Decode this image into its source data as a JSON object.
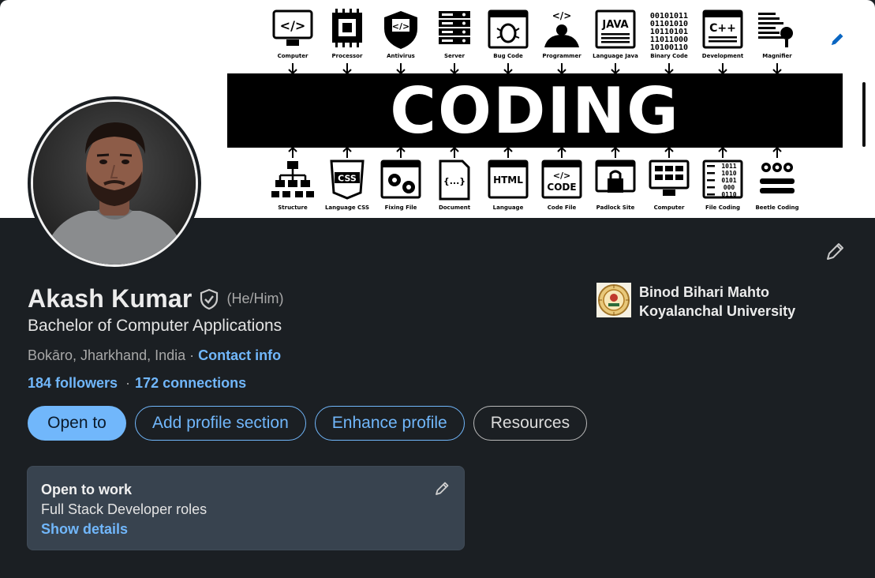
{
  "banner": {
    "top_icons": [
      "Computer",
      "Processor",
      "Antivirus",
      "Server",
      "Bug Code",
      "Programmer",
      "Language Java",
      "Binary Code",
      "Development",
      "Magnifier"
    ],
    "bottom_icons": [
      "Structure",
      "Language CSS",
      "Fixing File",
      "Document",
      "Language",
      "Code File",
      "Padlock Site",
      "Computer",
      "File Coding",
      "Beetle Coding"
    ],
    "title": "CODING",
    "binary_text": [
      "00101011",
      "01101010",
      "10110101",
      "11011000",
      "10100110"
    ],
    "icon_texts": {
      "computer": "</>",
      "antivirus": "</>",
      "programmer": "</>",
      "java": "JAVA",
      "cpp": "C++",
      "css": "CSS",
      "document": "{...}",
      "html": "HTML",
      "code_top": "</>",
      "code_bottom": "CODE",
      "file_binary": [
        "1011",
        "1010",
        "0101",
        "000",
        "0110"
      ]
    }
  },
  "profile": {
    "name": "Akash Kumar",
    "pronouns": "(He/Him)",
    "headline": "Bachelor of Computer Applications",
    "location": "Bokāro, Jharkhand, India",
    "location_sep": "·",
    "contact_info": "Contact info",
    "followers": "184 followers",
    "connections_sep": "·",
    "connections": "172 connections"
  },
  "school": {
    "line1": "Binod Bihari Mahto",
    "line2": "Koyalanchal University"
  },
  "actions": {
    "open_to": "Open to",
    "add_section": "Add profile section",
    "enhance": "Enhance profile",
    "resources": "Resources"
  },
  "open_to_work": {
    "title": "Open to work",
    "roles": "Full Stack Developer roles",
    "show_details": "Show details"
  },
  "colors": {
    "background": "#1b1f23",
    "accent": "#71b7fb",
    "card": "#38434f"
  }
}
